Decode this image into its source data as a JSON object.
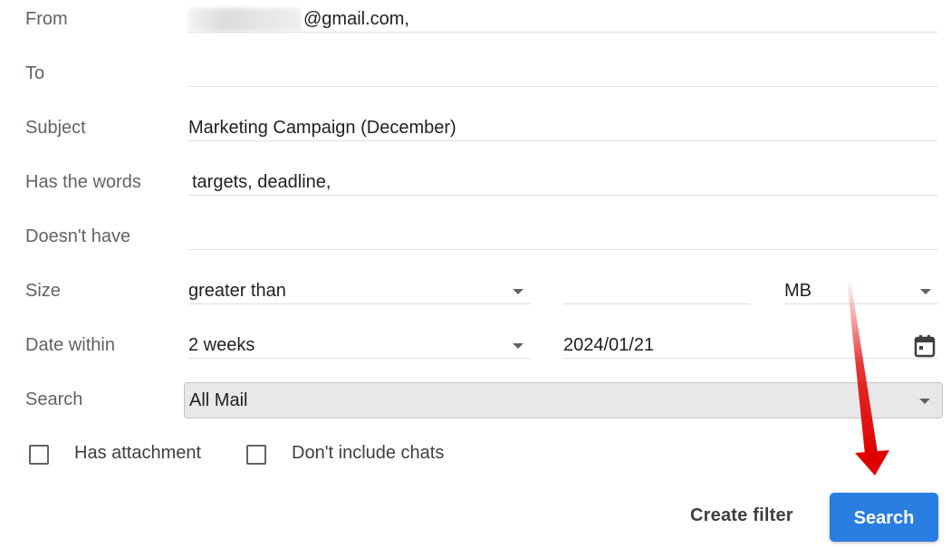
{
  "form": {
    "from": {
      "label": "From",
      "value": "@gmail.com,"
    },
    "to": {
      "label": "To",
      "value": ""
    },
    "subject": {
      "label": "Subject",
      "value": "Marketing Campaign (December)"
    },
    "has_words": {
      "label": "Has the words",
      "value": "targets, deadline,"
    },
    "doesnt_have": {
      "label": "Doesn't have",
      "value": ""
    },
    "size": {
      "label": "Size",
      "operator": "greater than",
      "value": "",
      "unit": "MB"
    },
    "date_within": {
      "label": "Date within",
      "range": "2 weeks",
      "date": "2024/01/21"
    },
    "search": {
      "label": "Search",
      "scope": "All Mail"
    },
    "has_attachment": {
      "label": "Has attachment",
      "checked": false
    },
    "dont_include_chats": {
      "label": "Don't include chats",
      "checked": false
    }
  },
  "actions": {
    "create_filter": "Create filter",
    "search": "Search"
  },
  "colors": {
    "accent": "#2a7de1",
    "annotation_arrow": "#e00000"
  },
  "icons": [
    "chevron-down-icon",
    "calendar-icon",
    "checkbox-icon",
    "arrow-annotation"
  ]
}
